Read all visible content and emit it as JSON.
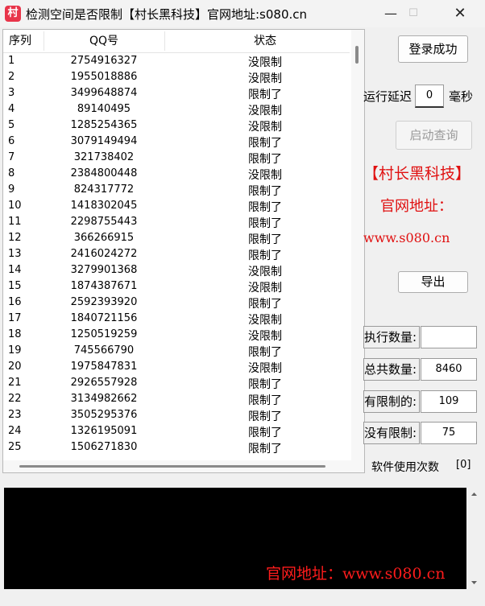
{
  "window": {
    "icon_char": "村",
    "title": "检测空间是否限制【村长黑科技】官网地址:s080.cn",
    "minimize": "—",
    "maximize": "☐",
    "close": "✕"
  },
  "table": {
    "headers": [
      "序列",
      "QQ号",
      "状态"
    ],
    "rows": [
      {
        "idx": "1",
        "qq": "2754916327",
        "status": "没限制"
      },
      {
        "idx": "2",
        "qq": "1955018886",
        "status": "没限制"
      },
      {
        "idx": "3",
        "qq": "3499648874",
        "status": "限制了"
      },
      {
        "idx": "4",
        "qq": "89140495",
        "status": "没限制"
      },
      {
        "idx": "5",
        "qq": "1285254365",
        "status": "没限制"
      },
      {
        "idx": "6",
        "qq": "3079149494",
        "status": "限制了"
      },
      {
        "idx": "7",
        "qq": "321738402",
        "status": "限制了"
      },
      {
        "idx": "8",
        "qq": "2384800448",
        "status": "没限制"
      },
      {
        "idx": "9",
        "qq": "824317772",
        "status": "限制了"
      },
      {
        "idx": "10",
        "qq": "1418302045",
        "status": "限制了"
      },
      {
        "idx": "11",
        "qq": "2298755443",
        "status": "限制了"
      },
      {
        "idx": "12",
        "qq": "366266915",
        "status": "限制了"
      },
      {
        "idx": "13",
        "qq": "2416024272",
        "status": "限制了"
      },
      {
        "idx": "14",
        "qq": "3279901368",
        "status": "没限制"
      },
      {
        "idx": "15",
        "qq": "1874387671",
        "status": "没限制"
      },
      {
        "idx": "16",
        "qq": "2592393920",
        "status": "限制了"
      },
      {
        "idx": "17",
        "qq": "1840721156",
        "status": "没限制"
      },
      {
        "idx": "18",
        "qq": "1250519259",
        "status": "没限制"
      },
      {
        "idx": "19",
        "qq": "745566790",
        "status": "限制了"
      },
      {
        "idx": "20",
        "qq": "1975847831",
        "status": "没限制"
      },
      {
        "idx": "21",
        "qq": "2926557928",
        "status": "限制了"
      },
      {
        "idx": "22",
        "qq": "3134982662",
        "status": "限制了"
      },
      {
        "idx": "23",
        "qq": "3505295376",
        "status": "限制了"
      },
      {
        "idx": "24",
        "qq": "1326195091",
        "status": "限制了"
      },
      {
        "idx": "25",
        "qq": "1506271830",
        "status": "限制了"
      }
    ]
  },
  "controls": {
    "login_button": "登录成功",
    "delay_label": "运行延迟",
    "delay_value": "0",
    "delay_unit": "毫秒",
    "start_button": "启动查询",
    "brand": "【村长黑科技】",
    "site_label": "官网地址：",
    "site_url": "www.s080.cn",
    "export_button": "导出"
  },
  "stats": {
    "executed_label": "执行数量:",
    "executed_value": "",
    "total_label": "总共数量:",
    "total_value": "8460",
    "limited_label": "有限制的:",
    "limited_value": "109",
    "unlimited_label": "没有限制:",
    "unlimited_value": "75",
    "usage_label": "软件使用次数",
    "usage_value": "[0]"
  },
  "console": {
    "text": "官网地址：www.s080.cn"
  },
  "colors": {
    "accent_red": "#e01010",
    "console_bg": "#000000",
    "app_icon": "#e8354a"
  }
}
